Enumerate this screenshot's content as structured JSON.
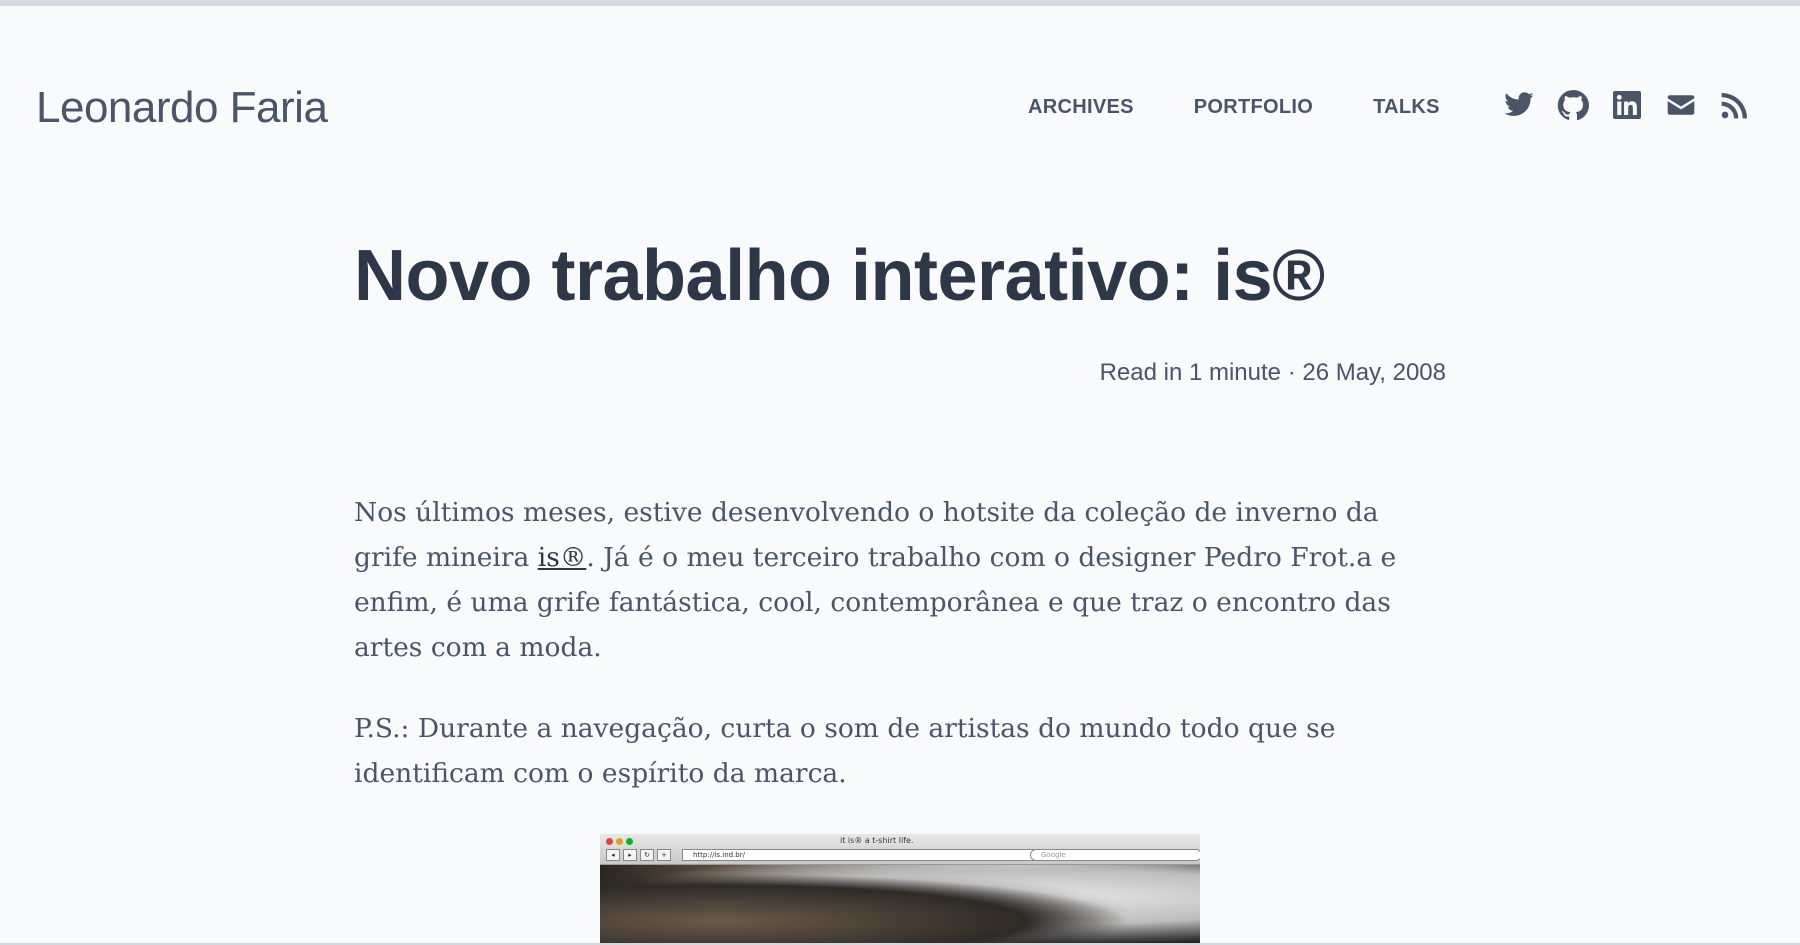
{
  "header": {
    "site_title": "Leonardo Faria",
    "nav": [
      {
        "label": "ARCHIVES"
      },
      {
        "label": "PORTFOLIO"
      },
      {
        "label": "TALKS"
      }
    ],
    "socials": [
      "twitter-icon",
      "github-icon",
      "linkedin-icon",
      "email-icon",
      "rss-icon"
    ]
  },
  "post": {
    "title": "Novo trabalho interativo: is®",
    "meta": "Read in 1 minute · 26 May, 2008",
    "paragraph1": {
      "before": "Nos últimos meses, estive desenvolvendo o hotsite da coleção de inverno da grife mineira ",
      "link": "is®",
      "after": ". Já é o meu terceiro trabalho com o designer Pedro Frot.a e enfim, é uma grife fantástica, cool, contemporânea e que traz o encontro das artes com a moda."
    },
    "paragraph2": "P.S.: Durante a navegação, curta o som de artistas do mundo todo que se identificam com o espírito da marca."
  },
  "screenshot": {
    "window_title": "it is® a t-shirt life.",
    "url": "http://is.ind.br/",
    "search_placeholder": "Google"
  },
  "colors": {
    "background": "#f8fafc",
    "text": "#2d3748",
    "muted": "#4a5568"
  }
}
